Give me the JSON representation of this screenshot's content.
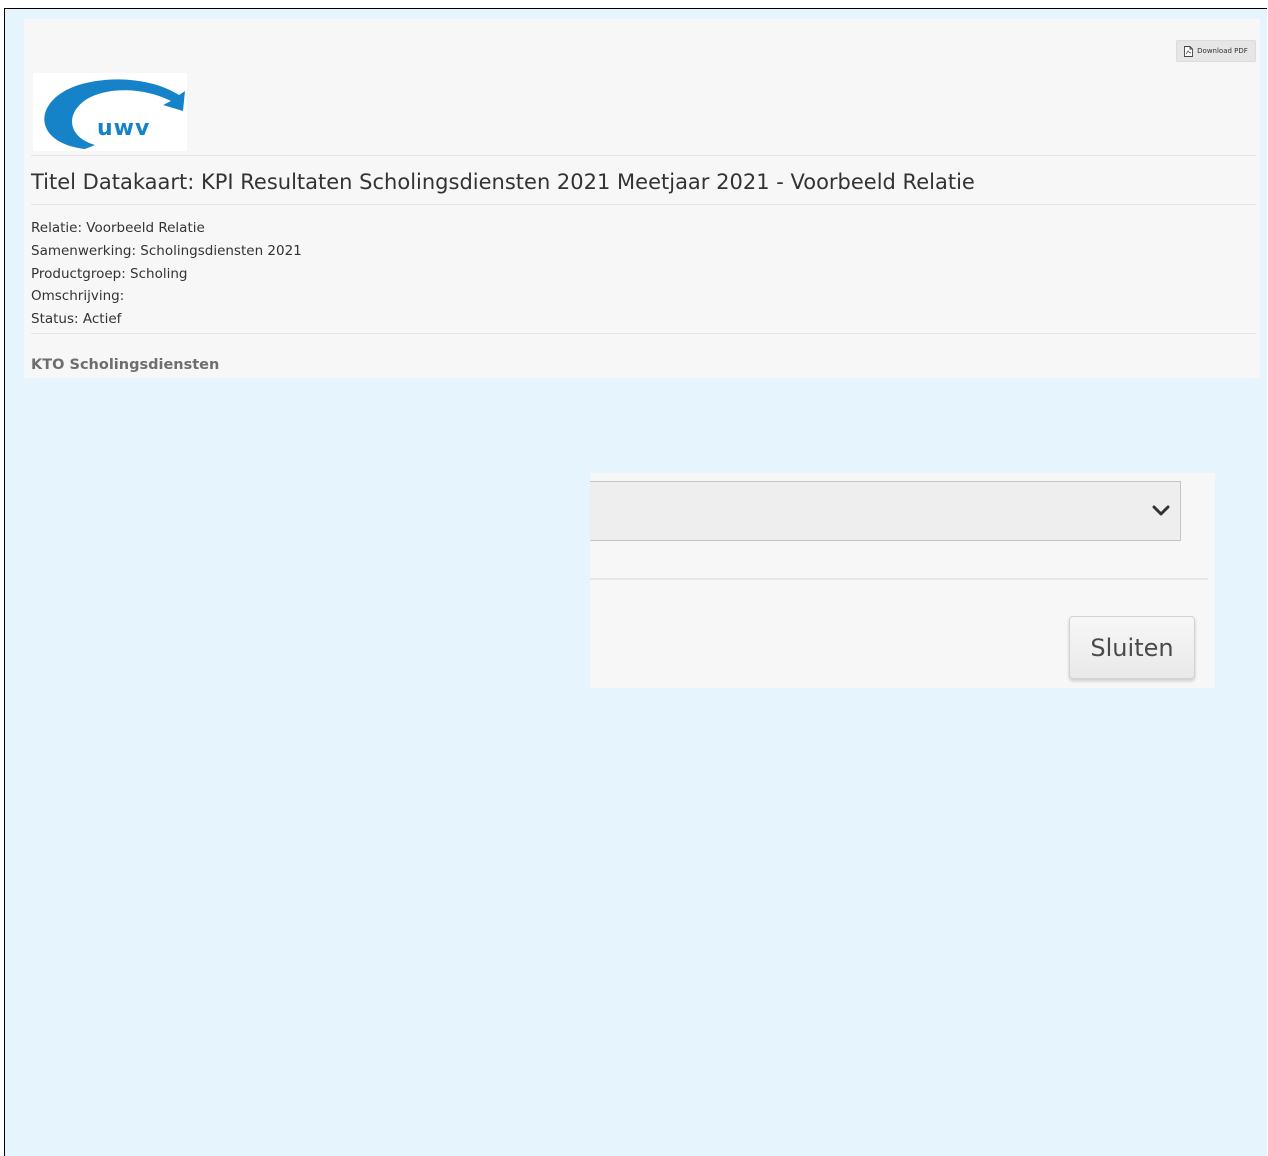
{
  "header": {
    "download_pdf_label": "Download PDF",
    "logo_text": "uwv"
  },
  "datakaart": {
    "title": "Titel Datakaart: KPI Resultaten Scholingsdiensten 2021 Meetjaar 2021 - Voorbeeld Relatie",
    "meta": [
      "Relatie: Voorbeeld Relatie",
      "Samenwerking: Scholingsdiensten 2021",
      "Productgroep: Scholing",
      "Omschrijving:",
      "Status: Actief"
    ],
    "section_heading": "KTO Scholingsdiensten"
  },
  "modal": {
    "select_value": "",
    "close_label": "Sluiten"
  },
  "colors": {
    "page_background": "#e6f5fd",
    "card_background": "#f7f7f7",
    "brand_blue": "#1683c9",
    "text": "#333333"
  }
}
